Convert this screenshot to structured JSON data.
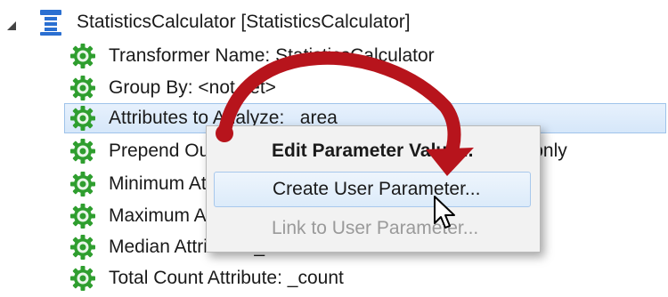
{
  "tree": {
    "root_label": "StatisticsCalculator [StatisticsCalculator]",
    "items": [
      {
        "label": "Transformer Name: StatisticsCalculator"
      },
      {
        "label": "Group By: <not set>"
      },
      {
        "label": "Attributes to Analyze: _area"
      },
      {
        "label": "Prepend Output Attribute Names: Calculate results only"
      },
      {
        "label": "Minimum Attribute: _min"
      },
      {
        "label": "Maximum Attribute: _max"
      },
      {
        "label": "Median Attribute: _median"
      },
      {
        "label": "Total Count Attribute: _count"
      }
    ]
  },
  "context_menu": {
    "items": [
      {
        "label": "Edit Parameter Value..."
      },
      {
        "label": "Create User Parameter..."
      },
      {
        "label": "Link to User Parameter..."
      }
    ]
  },
  "colors": {
    "gear": "#2f9e2f",
    "arrow": "#b7141c",
    "selection": "#d6e7fa"
  }
}
